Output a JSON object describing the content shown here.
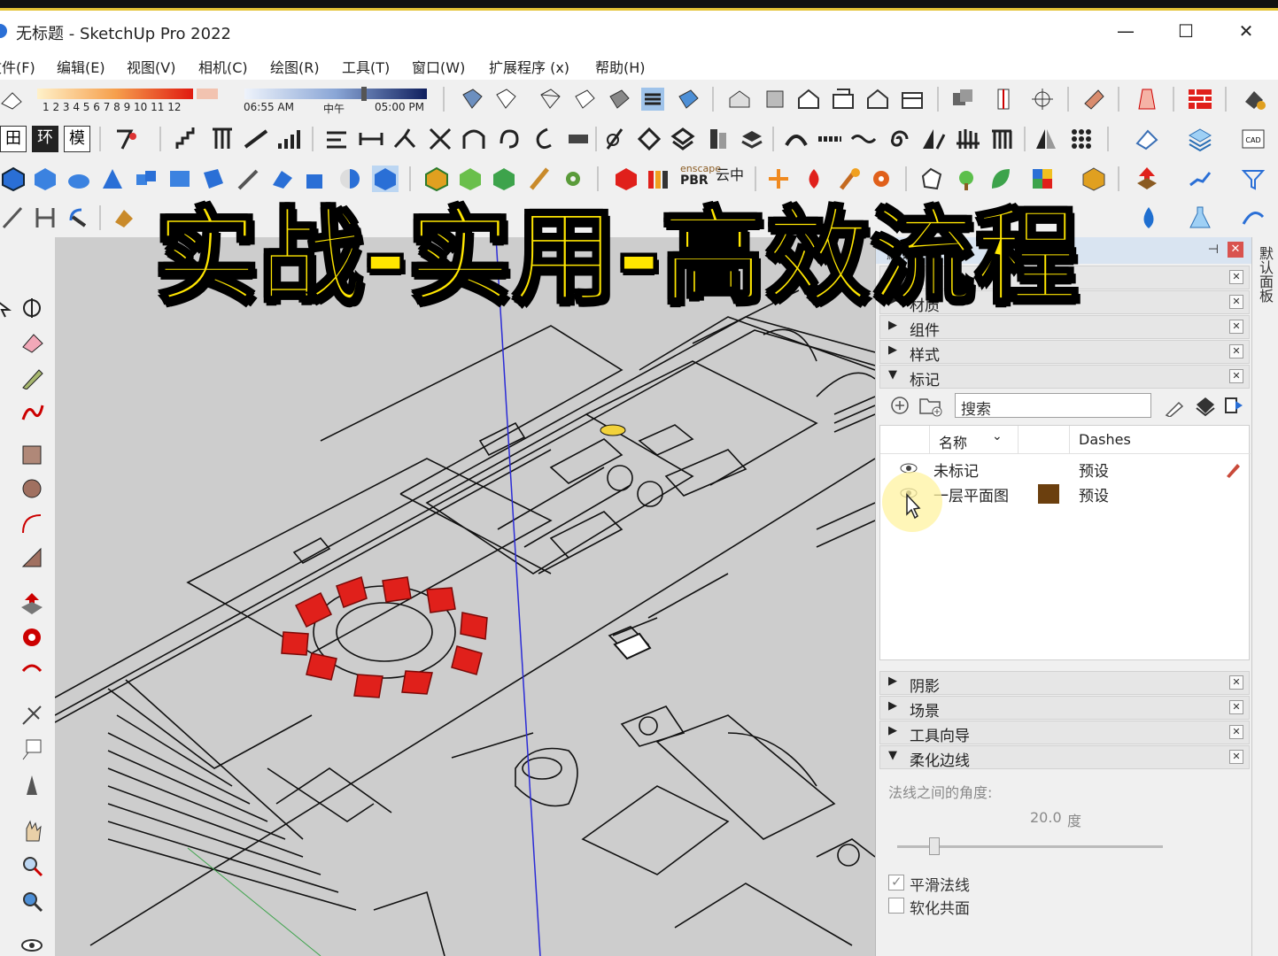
{
  "window": {
    "title": "无标题 - SketchUp Pro 2022",
    "minimize": "—",
    "maximize": "☐",
    "close": "✕"
  },
  "menu": [
    "文件(F)",
    "编辑(E)",
    "视图(V)",
    "相机(C)",
    "绘图(R)",
    "工具(T)",
    "窗口(W)",
    "扩展程序 (x)",
    "帮助(H)"
  ],
  "shadow_toolbar": {
    "months": "1 2 3 4 5 6 7 8 9 10 11 12",
    "time_start": "06:55 AM",
    "time_mid": "中午",
    "time_end": "05:00 PM"
  },
  "toolbar_text": {
    "buttons": [
      "田",
      "环",
      "模"
    ],
    "pbr_small": "enscape",
    "pbr_big": "PBR",
    "cloud": "云中"
  },
  "overlay_caption": "实战-实用-高效流程",
  "tray": {
    "title": "默认",
    "vertical_tab": "默认面板",
    "sections_top": [
      {
        "label": "材质",
        "arrow": "▶"
      },
      {
        "label": "组件",
        "arrow": "▶"
      },
      {
        "label": "样式",
        "arrow": "▶"
      },
      {
        "label": "标记",
        "arrow": "▼"
      }
    ],
    "tags": {
      "search_placeholder": "搜索",
      "col_name": "名称",
      "col_dashes": "Dashes",
      "rows": [
        {
          "name": "未标记",
          "dash": "预设",
          "color": null
        },
        {
          "name": "一层平面图",
          "dash": "预设",
          "color": "#6b3f0e"
        }
      ]
    },
    "sections_bottom": [
      {
        "label": "阴影",
        "arrow": "▶"
      },
      {
        "label": "场景",
        "arrow": "▶"
      },
      {
        "label": "工具向导",
        "arrow": "▶"
      },
      {
        "label": "柔化边线",
        "arrow": "▼"
      }
    ],
    "soften": {
      "angle_label": "法线之间的角度:",
      "angle_value": "20.0",
      "angle_unit": "度",
      "slider_fraction": 0.12,
      "smooth_label": "平滑法线",
      "smooth_checked": true,
      "coplanar_label": "软化共面",
      "coplanar_checked": false
    }
  },
  "colors": {
    "accent_red": "#e0201b",
    "overlay_yellow": "#ffe600",
    "tag_brown": "#6b3f0e",
    "tray_header": "#d9e4f1",
    "viewport_bg": "#cdcdcd"
  }
}
